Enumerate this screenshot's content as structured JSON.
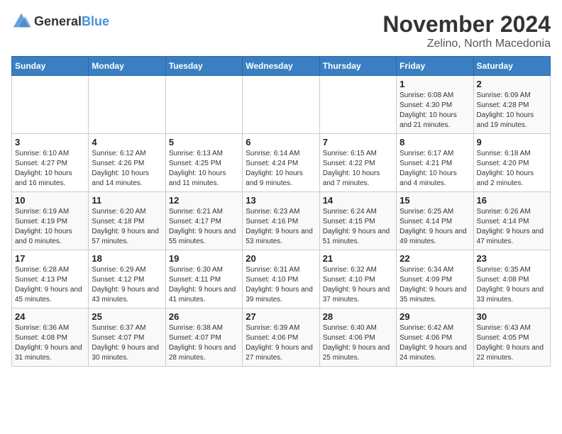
{
  "logo": {
    "text_general": "General",
    "text_blue": "Blue"
  },
  "calendar": {
    "title": "November 2024",
    "subtitle": "Zelino, North Macedonia"
  },
  "weekdays": [
    "Sunday",
    "Monday",
    "Tuesday",
    "Wednesday",
    "Thursday",
    "Friday",
    "Saturday"
  ],
  "weeks": [
    [
      {
        "day": "",
        "info": ""
      },
      {
        "day": "",
        "info": ""
      },
      {
        "day": "",
        "info": ""
      },
      {
        "day": "",
        "info": ""
      },
      {
        "day": "",
        "info": ""
      },
      {
        "day": "1",
        "info": "Sunrise: 6:08 AM\nSunset: 4:30 PM\nDaylight: 10 hours and 21 minutes."
      },
      {
        "day": "2",
        "info": "Sunrise: 6:09 AM\nSunset: 4:28 PM\nDaylight: 10 hours and 19 minutes."
      }
    ],
    [
      {
        "day": "3",
        "info": "Sunrise: 6:10 AM\nSunset: 4:27 PM\nDaylight: 10 hours and 16 minutes."
      },
      {
        "day": "4",
        "info": "Sunrise: 6:12 AM\nSunset: 4:26 PM\nDaylight: 10 hours and 14 minutes."
      },
      {
        "day": "5",
        "info": "Sunrise: 6:13 AM\nSunset: 4:25 PM\nDaylight: 10 hours and 11 minutes."
      },
      {
        "day": "6",
        "info": "Sunrise: 6:14 AM\nSunset: 4:24 PM\nDaylight: 10 hours and 9 minutes."
      },
      {
        "day": "7",
        "info": "Sunrise: 6:15 AM\nSunset: 4:22 PM\nDaylight: 10 hours and 7 minutes."
      },
      {
        "day": "8",
        "info": "Sunrise: 6:17 AM\nSunset: 4:21 PM\nDaylight: 10 hours and 4 minutes."
      },
      {
        "day": "9",
        "info": "Sunrise: 6:18 AM\nSunset: 4:20 PM\nDaylight: 10 hours and 2 minutes."
      }
    ],
    [
      {
        "day": "10",
        "info": "Sunrise: 6:19 AM\nSunset: 4:19 PM\nDaylight: 10 hours and 0 minutes."
      },
      {
        "day": "11",
        "info": "Sunrise: 6:20 AM\nSunset: 4:18 PM\nDaylight: 9 hours and 57 minutes."
      },
      {
        "day": "12",
        "info": "Sunrise: 6:21 AM\nSunset: 4:17 PM\nDaylight: 9 hours and 55 minutes."
      },
      {
        "day": "13",
        "info": "Sunrise: 6:23 AM\nSunset: 4:16 PM\nDaylight: 9 hours and 53 minutes."
      },
      {
        "day": "14",
        "info": "Sunrise: 6:24 AM\nSunset: 4:15 PM\nDaylight: 9 hours and 51 minutes."
      },
      {
        "day": "15",
        "info": "Sunrise: 6:25 AM\nSunset: 4:14 PM\nDaylight: 9 hours and 49 minutes."
      },
      {
        "day": "16",
        "info": "Sunrise: 6:26 AM\nSunset: 4:14 PM\nDaylight: 9 hours and 47 minutes."
      }
    ],
    [
      {
        "day": "17",
        "info": "Sunrise: 6:28 AM\nSunset: 4:13 PM\nDaylight: 9 hours and 45 minutes."
      },
      {
        "day": "18",
        "info": "Sunrise: 6:29 AM\nSunset: 4:12 PM\nDaylight: 9 hours and 43 minutes."
      },
      {
        "day": "19",
        "info": "Sunrise: 6:30 AM\nSunset: 4:11 PM\nDaylight: 9 hours and 41 minutes."
      },
      {
        "day": "20",
        "info": "Sunrise: 6:31 AM\nSunset: 4:10 PM\nDaylight: 9 hours and 39 minutes."
      },
      {
        "day": "21",
        "info": "Sunrise: 6:32 AM\nSunset: 4:10 PM\nDaylight: 9 hours and 37 minutes."
      },
      {
        "day": "22",
        "info": "Sunrise: 6:34 AM\nSunset: 4:09 PM\nDaylight: 9 hours and 35 minutes."
      },
      {
        "day": "23",
        "info": "Sunrise: 6:35 AM\nSunset: 4:08 PM\nDaylight: 9 hours and 33 minutes."
      }
    ],
    [
      {
        "day": "24",
        "info": "Sunrise: 6:36 AM\nSunset: 4:08 PM\nDaylight: 9 hours and 31 minutes."
      },
      {
        "day": "25",
        "info": "Sunrise: 6:37 AM\nSunset: 4:07 PM\nDaylight: 9 hours and 30 minutes."
      },
      {
        "day": "26",
        "info": "Sunrise: 6:38 AM\nSunset: 4:07 PM\nDaylight: 9 hours and 28 minutes."
      },
      {
        "day": "27",
        "info": "Sunrise: 6:39 AM\nSunset: 4:06 PM\nDaylight: 9 hours and 27 minutes."
      },
      {
        "day": "28",
        "info": "Sunrise: 6:40 AM\nSunset: 4:06 PM\nDaylight: 9 hours and 25 minutes."
      },
      {
        "day": "29",
        "info": "Sunrise: 6:42 AM\nSunset: 4:06 PM\nDaylight: 9 hours and 24 minutes."
      },
      {
        "day": "30",
        "info": "Sunrise: 6:43 AM\nSunset: 4:05 PM\nDaylight: 9 hours and 22 minutes."
      }
    ]
  ]
}
